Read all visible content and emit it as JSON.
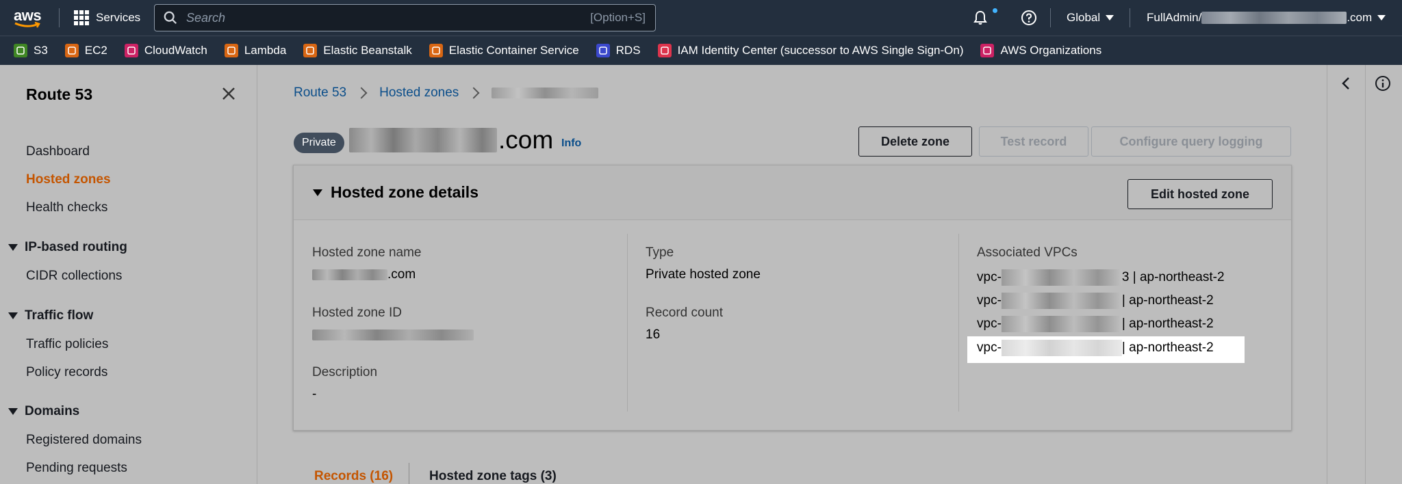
{
  "topnav": {
    "logo": "aws",
    "services_label": "Services",
    "search_placeholder": "Search",
    "search_shortcut": "[Option+S]",
    "region_label": "Global",
    "account_prefix": "FullAdmin/",
    "account_suffix": ".com"
  },
  "favorites": [
    {
      "label": "S3",
      "icon": "s3-icon",
      "color": "#3f8624"
    },
    {
      "label": "EC2",
      "icon": "ec2-icon",
      "color": "#d86613"
    },
    {
      "label": "CloudWatch",
      "icon": "cloudwatch-icon",
      "color": "#cc2264"
    },
    {
      "label": "Lambda",
      "icon": "lambda-icon",
      "color": "#d86613"
    },
    {
      "label": "Elastic Beanstalk",
      "icon": "beanstalk-icon",
      "color": "#d86613"
    },
    {
      "label": "Elastic Container Service",
      "icon": "ecs-icon",
      "color": "#d86613"
    },
    {
      "label": "RDS",
      "icon": "rds-icon",
      "color": "#3b48cc"
    },
    {
      "label": "IAM Identity Center (successor to AWS Single Sign-On)",
      "icon": "iam-identity-center-icon",
      "color": "#dd344c"
    },
    {
      "label": "AWS Organizations",
      "icon": "organizations-icon",
      "color": "#cc2264"
    }
  ],
  "sidebar": {
    "title": "Route 53",
    "items": {
      "dashboard": "Dashboard",
      "hosted_zones": "Hosted zones",
      "health_checks": "Health checks",
      "ip_routing": "IP-based routing",
      "cidr": "CIDR collections",
      "traffic_flow": "Traffic flow",
      "traffic_policies": "Traffic policies",
      "policy_records": "Policy records",
      "domains": "Domains",
      "registered_domains": "Registered domains",
      "pending_requests": "Pending requests"
    }
  },
  "breadcrumb": {
    "root": "Route 53",
    "parent": "Hosted zones"
  },
  "header": {
    "badge": "Private",
    "zone_suffix": ".com",
    "info": "Info",
    "delete_btn": "Delete zone",
    "test_btn": "Test record",
    "query_btn": "Configure query logging"
  },
  "details": {
    "title": "Hosted zone details",
    "edit_btn": "Edit hosted zone",
    "name_label": "Hosted zone name",
    "name_suffix": ".com",
    "id_label": "Hosted zone ID",
    "desc_label": "Description",
    "desc_value": "-",
    "type_label": "Type",
    "type_value": "Private hosted zone",
    "count_label": "Record count",
    "count_value": "16",
    "vpcs_label": "Associated VPCs",
    "vpcs": [
      {
        "prefix": "vpc-",
        "tail": "3 | ap-northeast-2"
      },
      {
        "prefix": "vpc-",
        "tail": " | ap-northeast-2"
      },
      {
        "prefix": "vpc-",
        "tail": " | ap-northeast-2"
      },
      {
        "prefix": "vpc-",
        "tail": " | ap-northeast-2"
      }
    ]
  },
  "tabs": {
    "records": "Records (16)",
    "tags": "Hosted zone tags (3)"
  }
}
